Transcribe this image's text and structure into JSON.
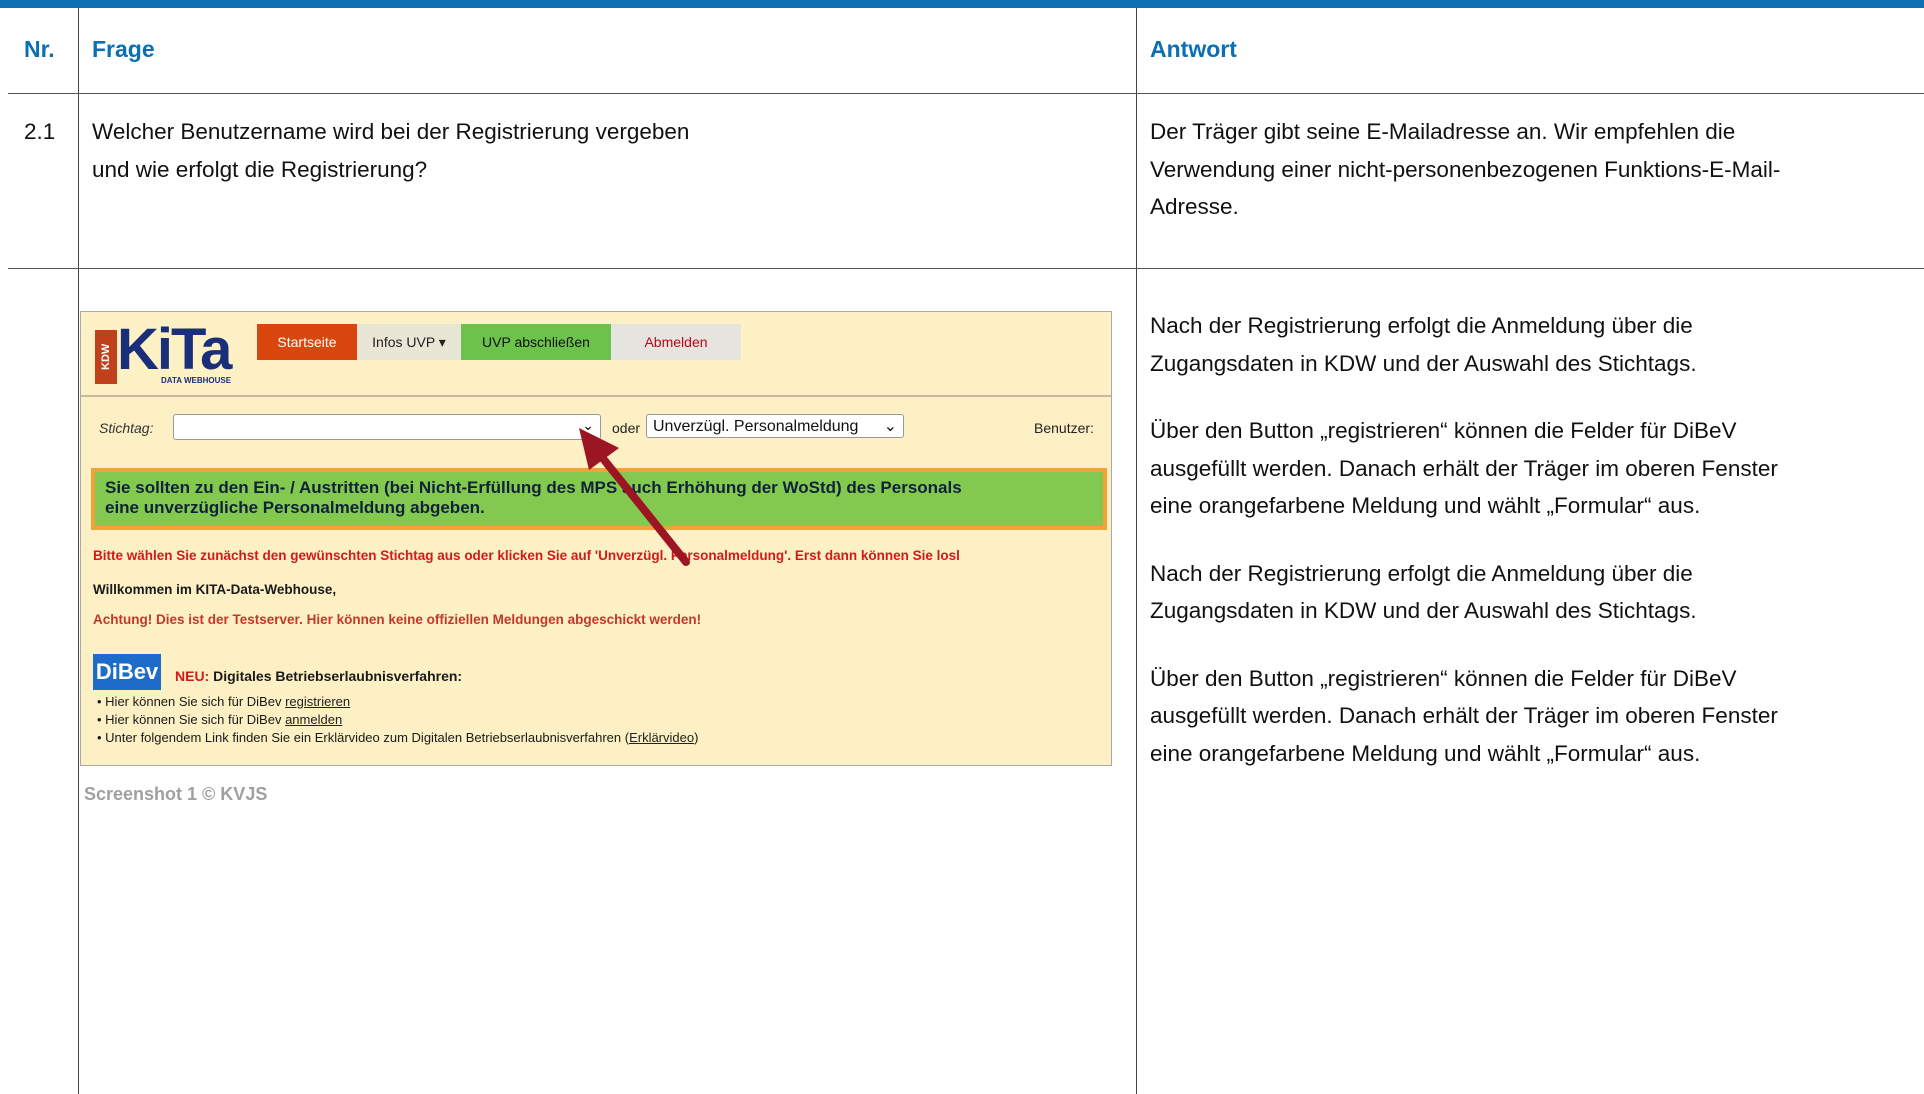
{
  "headers": {
    "nr": "Nr.",
    "frage": "Frage",
    "antwort": "Antwort"
  },
  "row1": {
    "nr": "2.1",
    "frage_lines": [
      "Welcher Benutzername wird bei der Registrierung vergeben",
      "und wie erfolgt die Registrierung?"
    ],
    "antwort_lines": [
      "Der Träger gibt seine E-Mailadresse an. Wir empfehlen die",
      "Verwendung einer nicht-personenbezogenen Funktions-E-Mail-",
      "Adresse."
    ]
  },
  "row2": {
    "caption": "Screenshot 1 © KVJS",
    "antwort_paragraphs": [
      [
        "Nach der Registrierung erfolgt die Anmeldung über die",
        "Zugangsdaten in KDW und der Auswahl des Stichtags."
      ],
      [
        "Über den Button „registrieren“ können die Felder für DiBeV",
        "ausgefüllt werden. Danach erhält der Träger im oberen Fenster",
        "eine orangefarbene Meldung und wählt „Formular“ aus."
      ],
      [
        "Nach der Registrierung erfolgt die Anmeldung über die",
        "Zugangsdaten in KDW und der Auswahl des Stichtags."
      ],
      [
        "Über den Button „registrieren“ können die Felder für DiBeV",
        "ausgefüllt werden. Danach erhält der Träger im oberen Fenster",
        "eine orangefarbene Meldung und wählt „Formular“ aus."
      ]
    ]
  },
  "screenshot": {
    "logo_vertical": "KDW",
    "logo_text": "KiTa",
    "logo_sub": "DATA WEBHOUSE",
    "nav": {
      "start": "Startseite",
      "infos": "Infos UVP ▾",
      "uvp": "UVP abschließen",
      "abmelden": "Abmelden"
    },
    "stichtag_label": "Stichtag:",
    "oder_label": "oder",
    "uvp_select": "Unverzügl. Personalmeldung",
    "benutzer_label": "Benutzer:",
    "notice_lines": [
      "Sie sollten zu den Ein- / Austritten (bei Nicht-Erfüllung des MPS auch Erhöhung der WoStd) des Personals",
      "eine unverzügliche Personalmeldung abgeben."
    ],
    "red_line": "Bitte wählen Sie zunächst den gewünschten Stichtag aus oder klicken Sie auf 'Unverzügl. Personalmeldung'. Erst dann können Sie losl",
    "welcome": "Willkommen im KITA-Data-Webhouse,",
    "warning": "Achtung! Dies ist der Testserver. Hier können keine offiziellen Meldungen abgeschickt werden!",
    "dibev_logo": "DiBev",
    "neu_tag": "NEU:",
    "neu_text": " Digitales Betriebserlaubnisverfahren:",
    "bullets": [
      {
        "text": "•  Hier können Sie sich für DiBev ",
        "link": "registrieren",
        "tail": ""
      },
      {
        "text": "•  Hier können Sie sich für DiBev ",
        "link": "anmelden",
        "tail": ""
      },
      {
        "text": "•  Unter folgendem Link finden Sie ein Erklärvideo zum Digitalen Betriebserlaubnisverfahren (",
        "link": "Erklärvideo",
        "tail": ")"
      }
    ]
  },
  "colors": {
    "accent": "#0a6fb3",
    "arrow": "#9b1622"
  }
}
